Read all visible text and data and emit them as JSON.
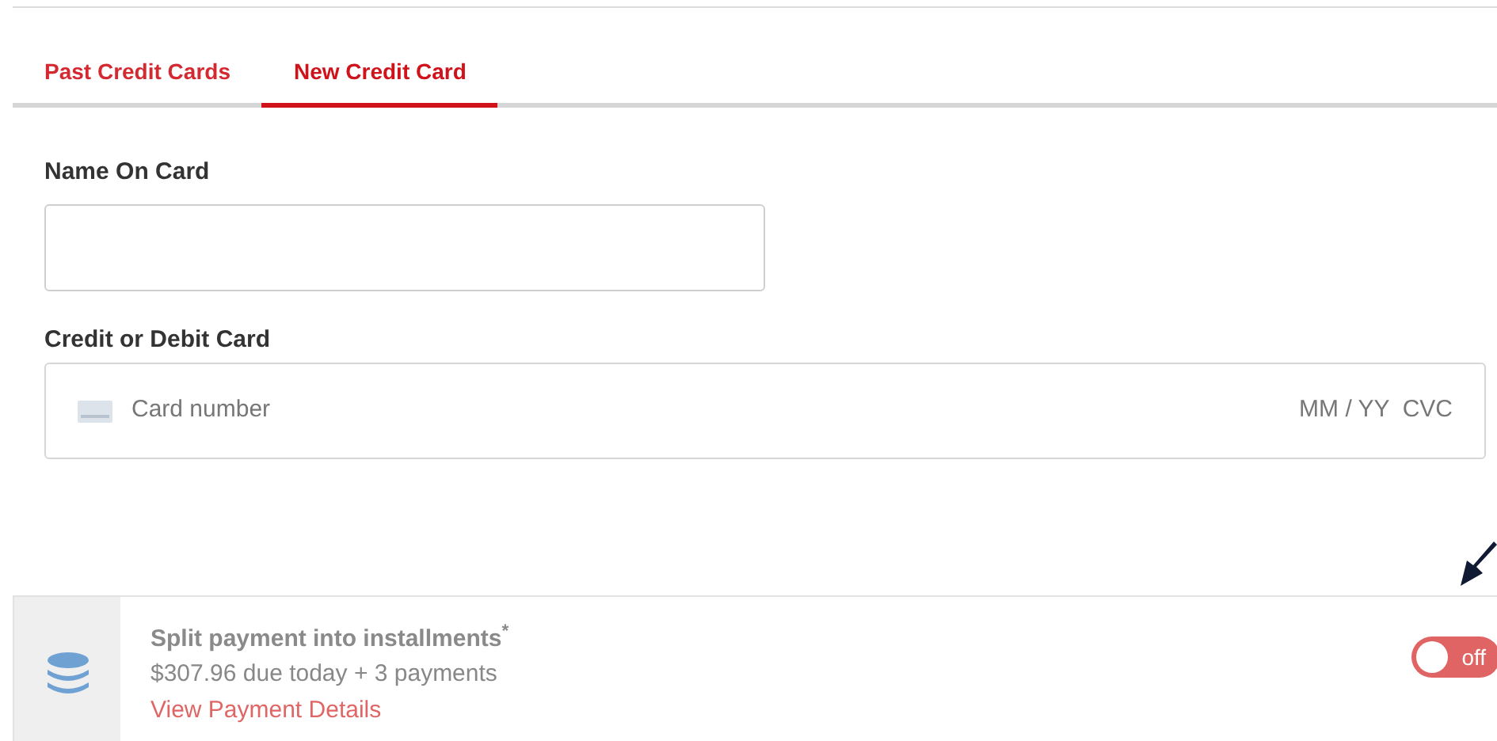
{
  "tabs": [
    {
      "label": "Past Credit Cards",
      "selected": false
    },
    {
      "label": "New Credit Card",
      "selected": true
    }
  ],
  "name_on_card": {
    "label": "Name On Card"
  },
  "card": {
    "label": "Credit or Debit Card",
    "placeholder": "Card number",
    "expiry_cvc": "MM / YY  CVC"
  },
  "installments": {
    "title": "Split payment into installments",
    "title_mark": "*",
    "summary": "$307.96 due today + 3 payments",
    "link": "View Payment Details",
    "toggle": {
      "on": false,
      "label": "off"
    }
  }
}
